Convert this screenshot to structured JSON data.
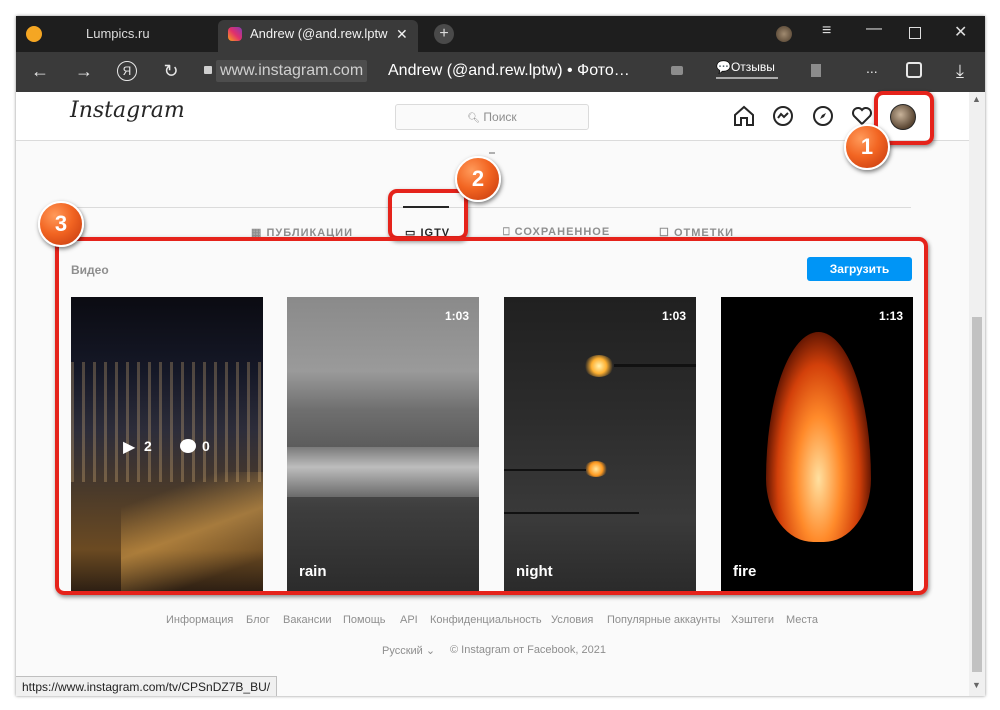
{
  "browser": {
    "tabs": [
      {
        "label": "Lumpics.ru"
      },
      {
        "label": "Andrew (@and.rew.lptw"
      }
    ],
    "url": "www.instagram.com",
    "page_title": "Andrew (@and.rew.lptw) • Фото…",
    "reviews_label": "Отзывы",
    "more_label": "..."
  },
  "instagram": {
    "logo": "Instagram",
    "search_placeholder": "Поиск",
    "profile_tabs": [
      {
        "label": "ПУБЛИКАЦИИ"
      },
      {
        "label": "IGTV"
      },
      {
        "label": "СОХРАНЕННОЕ"
      },
      {
        "label": "ОТМЕТКИ"
      }
    ],
    "section_label": "Видео",
    "upload_button": "Загрузить",
    "videos": [
      {
        "title": "",
        "duration": "",
        "views": "2",
        "comments": "0"
      },
      {
        "title": "rain",
        "duration": "1:03"
      },
      {
        "title": "night",
        "duration": "1:03"
      },
      {
        "title": "fire",
        "duration": "1:13"
      }
    ],
    "footer_links": [
      "Информация",
      "Блог",
      "Вакансии",
      "Помощь",
      "API",
      "Конфиденциальность",
      "Условия",
      "Популярные аккаунты",
      "Хэштеги",
      "Места"
    ],
    "language": "Русский",
    "copyright": "© Instagram от Facebook, 2021"
  },
  "annotations": [
    "1",
    "2",
    "3"
  ],
  "status_url": "https://www.instagram.com/tv/CPSnDZ7B_BU/",
  "colors": {
    "annotation_red": "#e5231b",
    "badge_orange": "#f26522",
    "upload_blue": "#0095f6"
  }
}
